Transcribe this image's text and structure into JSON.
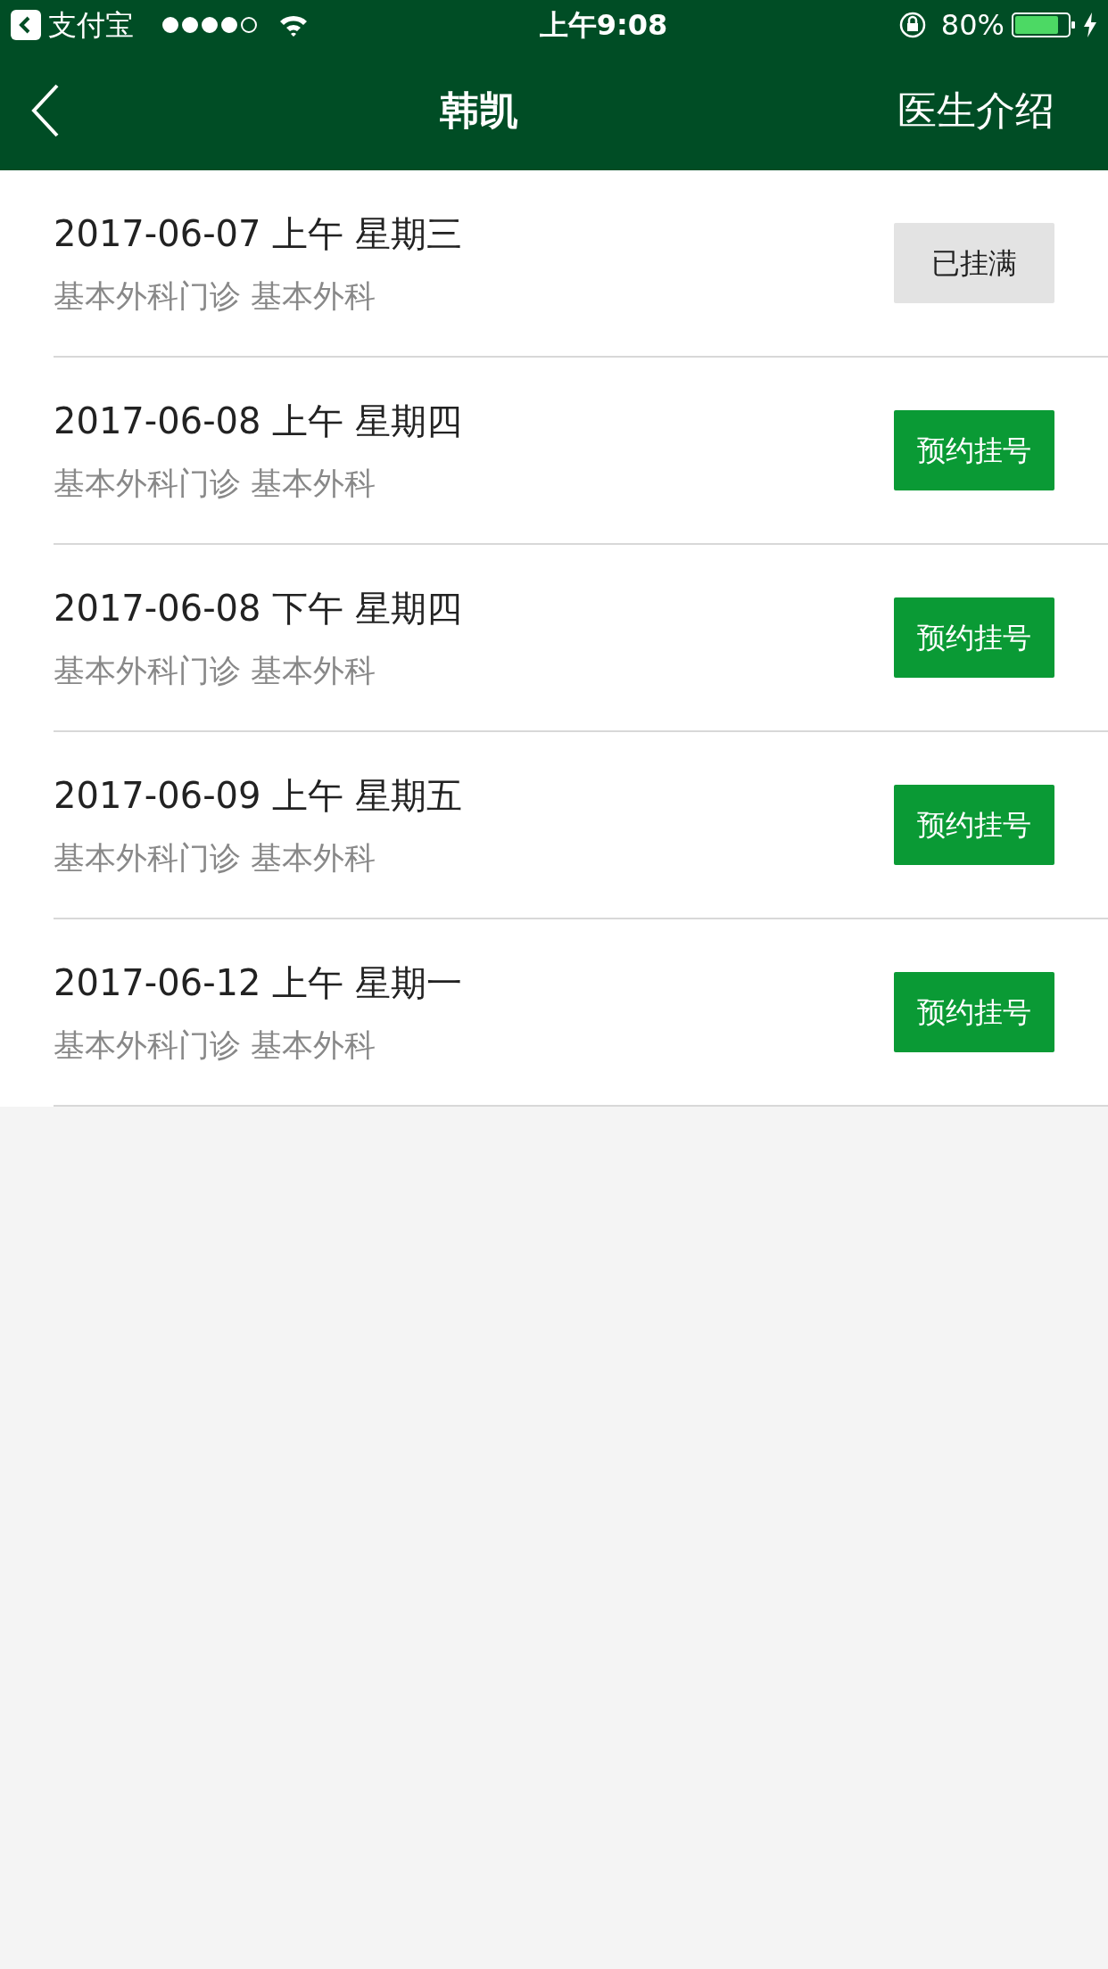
{
  "status_bar": {
    "back_app": "支付宝",
    "time": "上午9:08",
    "battery": "80%"
  },
  "nav": {
    "title": "韩凯",
    "action": "医生介绍"
  },
  "slots": [
    {
      "date": "2017-06-07 上午 星期三",
      "department": "基本外科门诊 基本外科",
      "button": "已挂满",
      "disabled": true
    },
    {
      "date": "2017-06-08 上午 星期四",
      "department": "基本外科门诊 基本外科",
      "button": "预约挂号",
      "disabled": false
    },
    {
      "date": "2017-06-08 下午 星期四",
      "department": "基本外科门诊 基本外科",
      "button": "预约挂号",
      "disabled": false
    },
    {
      "date": "2017-06-09 上午 星期五",
      "department": "基本外科门诊 基本外科",
      "button": "预约挂号",
      "disabled": false
    },
    {
      "date": "2017-06-12 上午 星期一",
      "department": "基本外科门诊 基本外科",
      "button": "预约挂号",
      "disabled": false
    }
  ]
}
